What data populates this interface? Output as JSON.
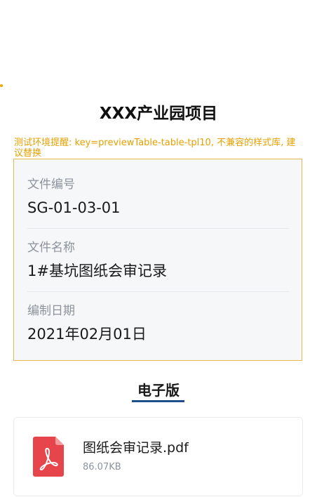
{
  "project": {
    "title": "XXX产业园项目"
  },
  "env_warning": "测试环境提醒: key=previewTable-table-tpl10, 不兼容的样式库, 建议替换",
  "info": {
    "doc_number_label": "文件编号",
    "doc_number_value": "SG-01-03-01",
    "doc_name_label": "文件名称",
    "doc_name_value": "1#基坑图纸会审记录",
    "date_label": "编制日期",
    "date_value": "2021年02月01日"
  },
  "electronic": {
    "section_title": "电子版",
    "file": {
      "name": "图纸会审记录.pdf",
      "size": "86.07KB",
      "icon": "pdf-icon"
    }
  },
  "colors": {
    "warning": "#e6a100",
    "card_border": "#e8b94a",
    "card_bg": "#f6f7f9",
    "accent": "#1f4e8c",
    "pdf_red": "#e5454b"
  }
}
